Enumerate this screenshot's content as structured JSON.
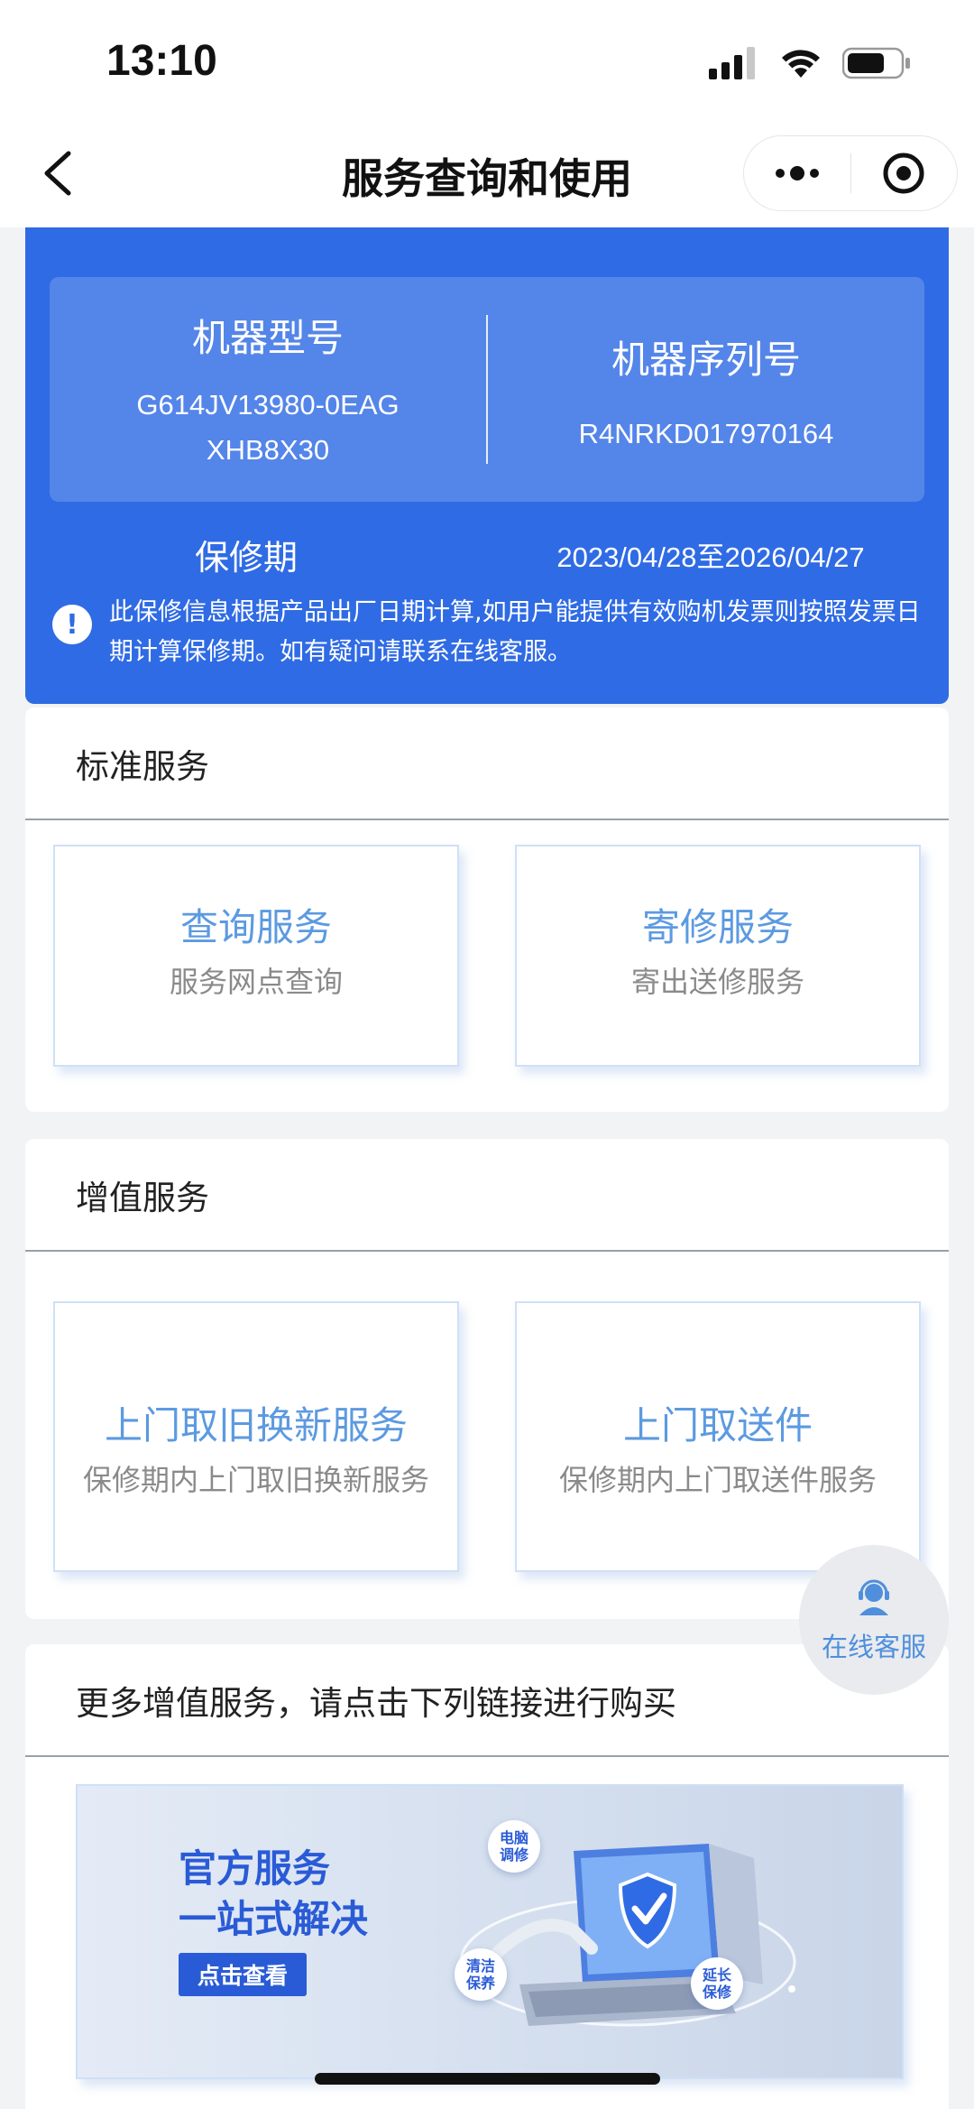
{
  "status_bar": {
    "time": "13:10"
  },
  "nav": {
    "title": "服务查询和使用"
  },
  "machine_info": {
    "model_label": "机器型号",
    "model_value": "G614JV13980-0EAGXHB8X30",
    "serial_label": "机器序列号",
    "serial_value": "R4NRKD017970164",
    "warranty_label": "保修期",
    "warranty_value": "2023/04/28至2026/04/27",
    "notice": "此保修信息根据产品出厂日期计算,如用户能提供有效购机发票则按照发票日期计算保修期。如有疑问请联系在线客服。"
  },
  "standard_services": {
    "heading": "标准服务",
    "items": [
      {
        "title": "查询服务",
        "subtitle": "服务网点查询"
      },
      {
        "title": "寄修服务",
        "subtitle": "寄出送修服务"
      }
    ]
  },
  "value_added_services": {
    "heading": "增值服务",
    "items": [
      {
        "title": "上门取旧换新服务",
        "subtitle": "保修期内上门取旧换新服务"
      },
      {
        "title": "上门取送件",
        "subtitle": "保修期内上门取送件服务"
      }
    ]
  },
  "more_services": {
    "heading": "更多增值服务，请点击下列链接进行购买",
    "banner": {
      "line1": "官方服务",
      "line2": "一站式解决",
      "button": "点击查看",
      "tags": [
        "电脑调修",
        "清洁保养",
        "延长保修"
      ]
    }
  },
  "float_button": {
    "label": "在线客服",
    "icon": "customer-service-icon"
  },
  "colors": {
    "primary_blue": "#2f6be4",
    "link_blue": "#5c9ae0",
    "banner_blue": "#2a5bd7"
  }
}
